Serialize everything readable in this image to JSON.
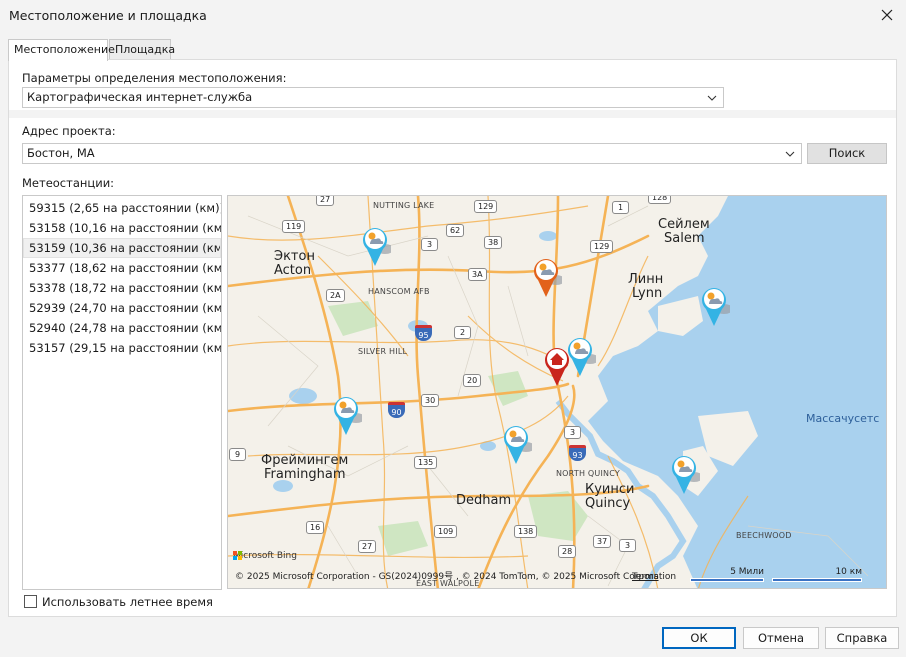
{
  "window": {
    "title": "Местоположение и площадка"
  },
  "tabs": [
    {
      "label": "Местоположение"
    },
    {
      "label": "Площадка"
    }
  ],
  "location": {
    "params_label": "Параметры определения местоположения:",
    "service_value": "Картографическая интернет-служба",
    "address_label": "Адрес проекта:",
    "address_value": "Бостон, MA",
    "search_label": "Поиск",
    "stations_label": "Метеостанции:",
    "stations": [
      {
        "label": "59315 (2,65 на расстоянии (км))"
      },
      {
        "label": "53158 (10,16 на расстоянии (км))"
      },
      {
        "label": "53159 (10,36 на расстоянии (км))"
      },
      {
        "label": "53377 (18,62 на расстоянии (км))"
      },
      {
        "label": "53378 (18,72 на расстоянии (км))"
      },
      {
        "label": "52939 (24,70 на расстоянии (км))"
      },
      {
        "label": "52940 (24,78 на расстоянии (км))"
      },
      {
        "label": "53157 (29,15 на расстоянии (км))"
      }
    ],
    "selected_station_index": 2,
    "dst_label": "Использовать летнее время",
    "dst_checked": false
  },
  "map": {
    "places": {
      "acton_ru": "Эктон",
      "acton_en": "Acton",
      "salem_ru": "Сейлем",
      "salem_en": "Salem",
      "lynn_ru": "Линн",
      "lynn_en": "Lynn",
      "framingham_ru": "Фреймингем",
      "framingham_en": "Framingham",
      "dedham": "Dedham",
      "quincy_ru": "Куинси",
      "quincy_en": "Quincy",
      "massachusetts": "Массачусетс",
      "nutting_lake": "NUTTING LAKE",
      "hanscom": "HANSCOM AFB",
      "silver_hill": "SILVER HILL",
      "north_quincy": "NORTH QUINCY",
      "beechwood": "BEECHWOOD",
      "east_walpole": "EAST WALPOLE"
    },
    "routes": {
      "r27a": "27",
      "r129a": "129",
      "r1": "1",
      "r128": "128",
      "r119": "119",
      "r62": "62",
      "r3a": "3",
      "r38": "38",
      "r129b": "129",
      "r3A": "3A",
      "r2A": "2A",
      "r2": "2",
      "r20": "20",
      "r30": "30",
      "r9": "9",
      "r135": "135",
      "r3b": "3",
      "r16": "16",
      "r27b": "27",
      "r109": "109",
      "r138": "138",
      "r28": "28",
      "r37": "37",
      "r3c": "3",
      "i95": "95",
      "i90": "90",
      "i93": "93"
    },
    "copyright": "© 2025 Microsoft Corporation - GS(2024)0999号 , © 2024 TomTom, © 2025 Microsoft Corporation",
    "terms": "Terms",
    "scale_miles": "5 Мили",
    "scale_km": "10 км",
    "ms_logo_text": "Microsoft Bing",
    "colors": {
      "water": "#a9d1ee",
      "land": "#f4f1ea",
      "park": "#cfe6c2",
      "road": "#f5b356",
      "home_pin": "#c9251c",
      "station_pin": "#34b3e4",
      "selected_pin": "#e2621b"
    }
  },
  "footer": {
    "ok": "ОК",
    "cancel": "Отмена",
    "help": "Справка"
  }
}
